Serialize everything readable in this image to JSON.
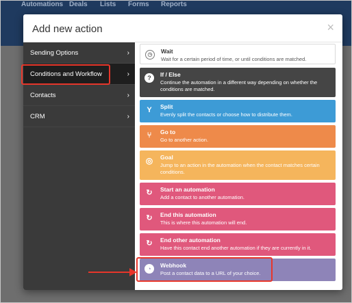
{
  "background_nav": {
    "items": [
      "Automations",
      "Deals",
      "Lists",
      "Forms",
      "Reports"
    ]
  },
  "modal": {
    "title": "Add new action",
    "close": "×"
  },
  "sidebar": {
    "chevron": "›",
    "items": [
      {
        "label": "Sending Options",
        "active": false
      },
      {
        "label": "Conditions and Workflow",
        "active": true
      },
      {
        "label": "Contacts",
        "active": false
      },
      {
        "label": "CRM",
        "active": false
      }
    ]
  },
  "actions": [
    {
      "title": "Wait",
      "desc": "Wait for a certain period of time, or until conditions are matched.",
      "color": "#ffffff",
      "icon": "clock-icon"
    },
    {
      "title": "If / Else",
      "desc": "Continue the automation in a different way depending on whether the conditions are matched.",
      "color": "#454545",
      "icon": "question-icon"
    },
    {
      "title": "Split",
      "desc": "Evenly split the contacts or choose how to distribute them.",
      "color": "#3d9bd6",
      "icon": "split-icon"
    },
    {
      "title": "Go to",
      "desc": "Go to another action.",
      "color": "#ee8a4a",
      "icon": "goto-icon"
    },
    {
      "title": "Goal",
      "desc": "Jump to an action in the automation when the contact matches certain conditions.",
      "color": "#f5b55c",
      "icon": "target-icon"
    },
    {
      "title": "Start an automation",
      "desc": "Add a contact to another automation.",
      "color": "#e0587c",
      "icon": "refresh-icon"
    },
    {
      "title": "End this automation",
      "desc": "This is where this automation will end.",
      "color": "#e0587c",
      "icon": "refresh-icon"
    },
    {
      "title": "End other automation",
      "desc": "Have this contact end another automation if they are currently in it.",
      "color": "#e0587c",
      "icon": "refresh-icon"
    },
    {
      "title": "Webhook",
      "desc": "Post a contact data to a URL of your choice.",
      "color": "#8e84b8",
      "icon": "webhook-icon"
    }
  ]
}
